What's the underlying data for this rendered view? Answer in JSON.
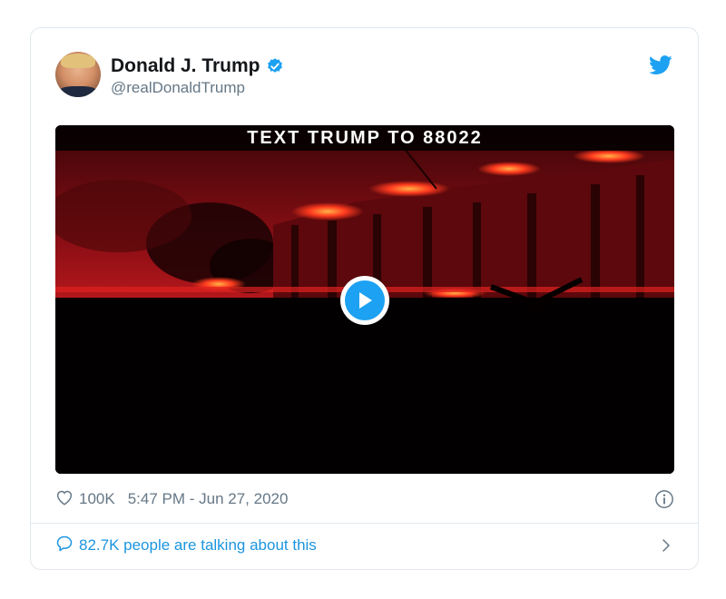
{
  "author": {
    "display_name": "Donald J. Trump",
    "handle": "@realDonaldTrump",
    "verified": true
  },
  "icons": {
    "verified": "verified-badge-icon",
    "brand": "twitter-bird-icon",
    "like": "heart-icon",
    "info": "info-icon",
    "reply": "speech-bubble-icon",
    "chevron": "chevron-right-icon",
    "play": "play-icon"
  },
  "media": {
    "overlay_text": "TEXT TRUMP TO 88022"
  },
  "stats": {
    "likes": "100K",
    "timestamp": "5:47 PM - Jun 27, 2020"
  },
  "conversation": {
    "text": "82.7K people are talking about this"
  },
  "colors": {
    "brand_blue": "#1da1f2",
    "link_blue": "#1b95e0",
    "muted": "#657786",
    "text": "#14171a",
    "border": "#e1e8ed"
  }
}
